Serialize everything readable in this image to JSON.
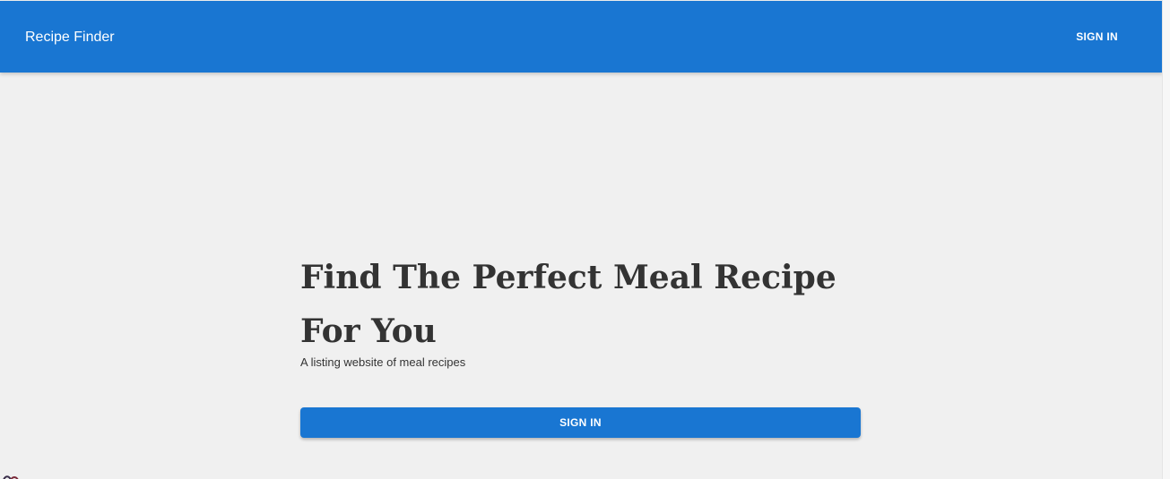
{
  "header": {
    "brand": "Recipe Finder",
    "sign_in_label": "SIGN IN"
  },
  "hero": {
    "title": "Find The Perfect Meal Recipe For You",
    "subtitle": "A listing website of meal recipes",
    "sign_in_label": "SIGN IN"
  },
  "colors": {
    "primary": "#1976d2",
    "background": "#f0f0f0",
    "text": "#333333"
  }
}
